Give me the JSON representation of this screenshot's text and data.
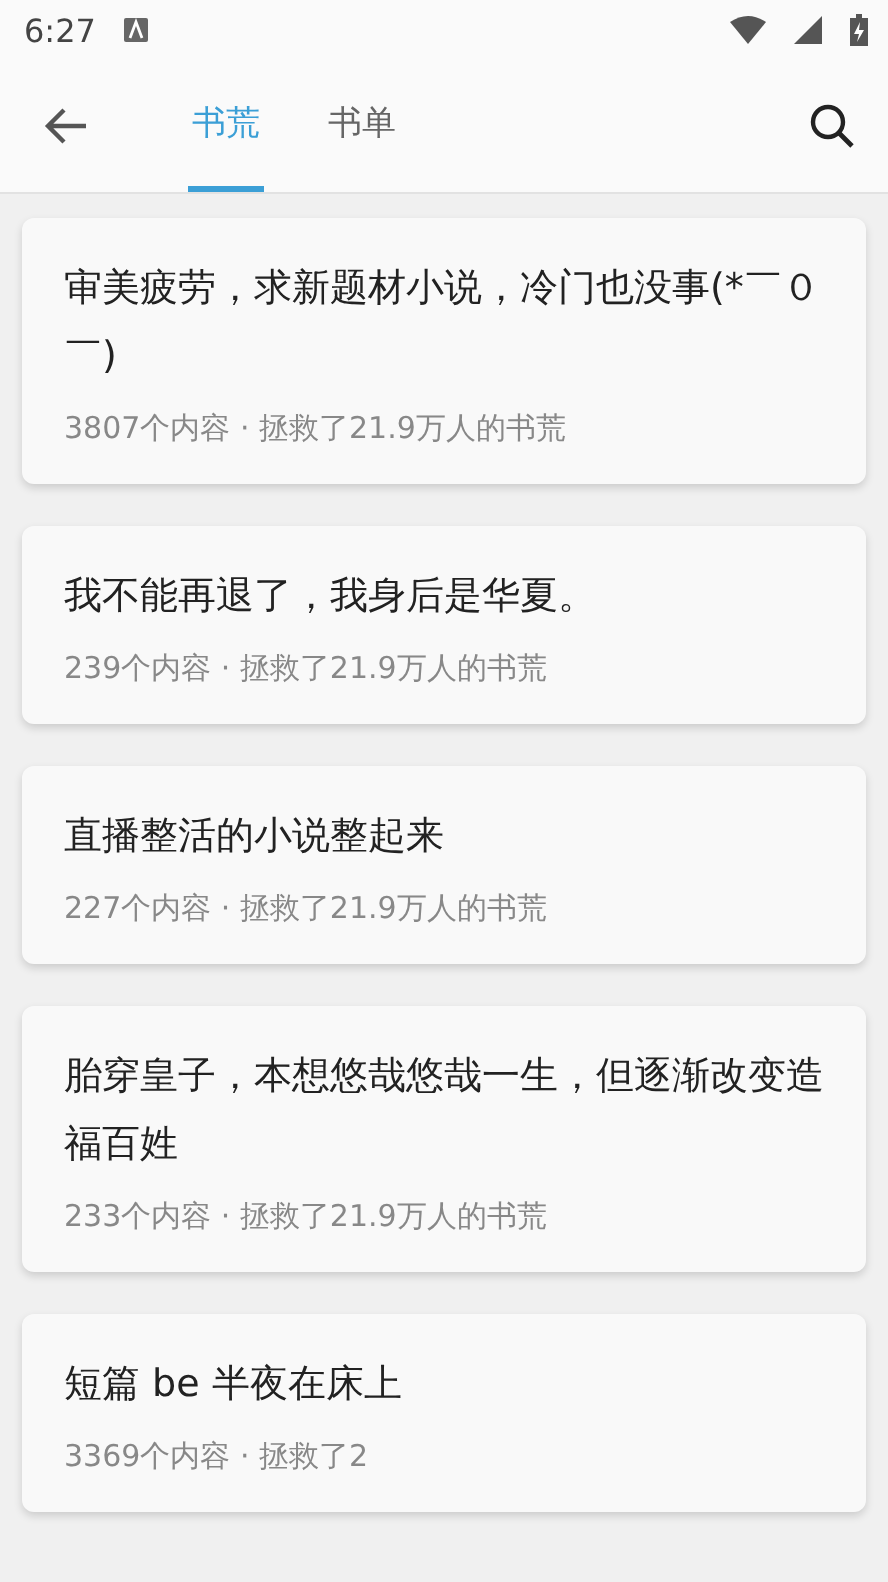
{
  "status_bar": {
    "time": "6:27"
  },
  "tabs": [
    {
      "label": "书荒",
      "selected": true
    },
    {
      "label": "书单",
      "selected": false
    }
  ],
  "cards": [
    {
      "title": "审美疲劳，求新题材小说，冷门也没事(*￣０￣)",
      "meta": "3807个内容 · 拯救了21.9万人的书荒"
    },
    {
      "title": "我不能再退了，我身后是华夏。",
      "meta": "239个内容 · 拯救了21.9万人的书荒"
    },
    {
      "title": "直播整活的小说整起来",
      "meta": "227个内容 · 拯救了21.9万人的书荒"
    },
    {
      "title": "胎穿皇子，本想悠哉悠哉一生，但逐渐改变造福百姓",
      "meta": "233个内容 · 拯救了21.9万人的书荒"
    },
    {
      "title": "短篇 be 半夜在床上",
      "meta": "3369个内容 · 拯救了2"
    }
  ]
}
